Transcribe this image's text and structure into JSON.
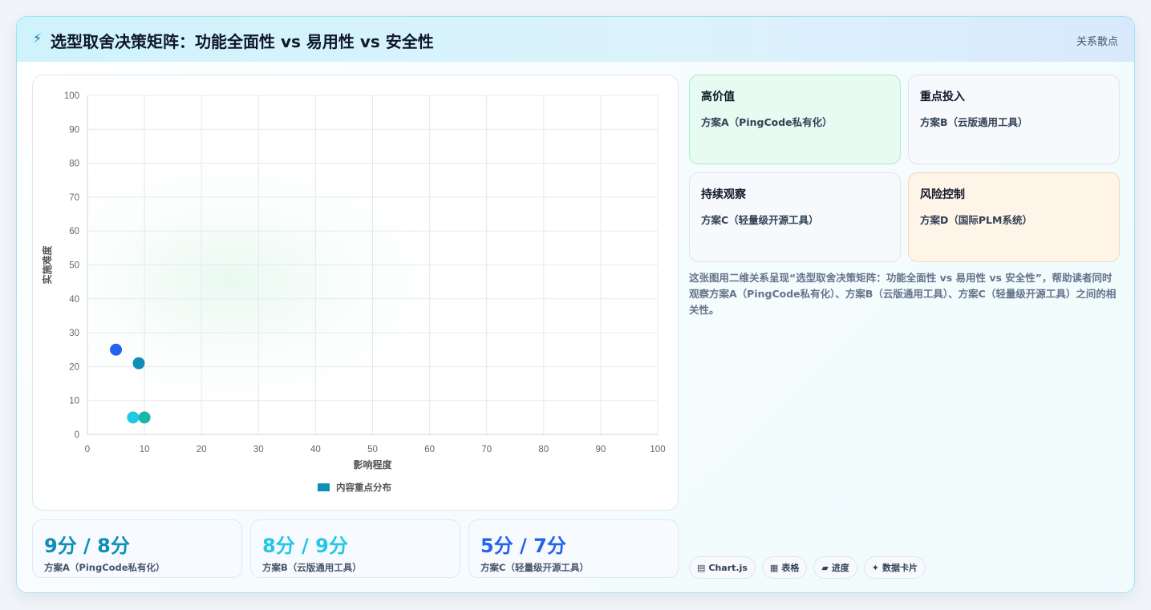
{
  "header": {
    "icon": "⚡",
    "title": "选型取舍决策矩阵：功能全面性 vs 易用性 vs 安全性",
    "tag": "关系散点"
  },
  "chart_data": {
    "type": "scatter",
    "xlabel": "影响程度",
    "ylabel": "实施难度",
    "xlim": [
      0,
      100
    ],
    "ylim": [
      0,
      100
    ],
    "x_ticks": [
      "0",
      "10",
      "20",
      "30",
      "40",
      "50",
      "60",
      "70",
      "80",
      "90",
      "100"
    ],
    "y_ticks": [
      "0",
      "10",
      "20",
      "30",
      "40",
      "50",
      "60",
      "70",
      "80",
      "90",
      "100"
    ],
    "grid": true,
    "legend": "bottom",
    "series": [
      {
        "name": "内容重点分布",
        "color": "#0e8fb8",
        "points": [
          {
            "x": 5,
            "y": 25,
            "color": "#2563eb"
          },
          {
            "x": 9,
            "y": 21,
            "color": "#0e8fb8"
          },
          {
            "x": 8,
            "y": 5,
            "color": "#22c8e5"
          },
          {
            "x": 10,
            "y": 5,
            "color": "#14b8a6"
          }
        ]
      }
    ]
  },
  "quadrants": [
    {
      "title": "高价值",
      "item": "方案A（PingCode私有化）"
    },
    {
      "title": "重点投入",
      "item": "方案B（云版通用工具）"
    },
    {
      "title": "持续观察",
      "item": "方案C（轻量级开源工具）"
    },
    {
      "title": "风险控制",
      "item": "方案D（国际PLM系统）"
    }
  ],
  "description": "这张图用二维关系呈现“选型取舍决策矩阵：功能全面性 vs 易用性 vs 安全性”，帮助读者同时观察方案A（PingCode私有化）、方案B（云版通用工具）、方案C（轻量级开源工具）之间的相关性。",
  "stats": [
    {
      "value": "9分 / 8分",
      "label": "方案A（PingCode私有化）",
      "color": "#0e8fb8"
    },
    {
      "value": "8分 / 9分",
      "label": "方案B（云版通用工具）",
      "color": "#22c8e5"
    },
    {
      "value": "5分 / 7分",
      "label": "方案C（轻量级开源工具）",
      "color": "#2563eb"
    }
  ],
  "pills": [
    {
      "icon": "chart-icon",
      "glyph": "▤",
      "label": "Chart.js"
    },
    {
      "icon": "table-icon",
      "glyph": "▦",
      "label": "表格"
    },
    {
      "icon": "progress-icon",
      "glyph": "▰",
      "label": "进度"
    },
    {
      "icon": "sparkle-icon",
      "glyph": "✦",
      "label": "数据卡片"
    }
  ]
}
